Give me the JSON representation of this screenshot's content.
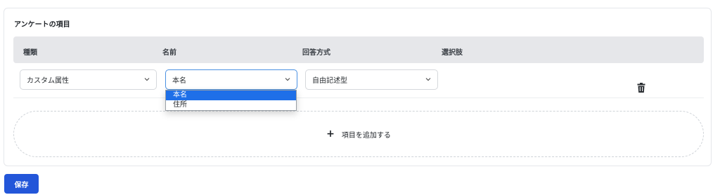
{
  "section": {
    "title": "アンケートの項目"
  },
  "table": {
    "headers": [
      "種類",
      "名前",
      "回答方式",
      "選択肢"
    ]
  },
  "row": {
    "type_value": "カスタム属性",
    "name_value": "本名",
    "answer_value": "自由記述型",
    "delete_icon": "trash-icon"
  },
  "dropdown": {
    "options": [
      "本名",
      "住所"
    ],
    "selected_index": 0
  },
  "add_item": {
    "icon": "plus-icon",
    "label": "項目を追加する"
  },
  "actions": {
    "save_label": "保存"
  },
  "colors": {
    "primary": "#2356d9",
    "selected_option": "#1e6fe8",
    "focus_border": "#4a90e2"
  }
}
